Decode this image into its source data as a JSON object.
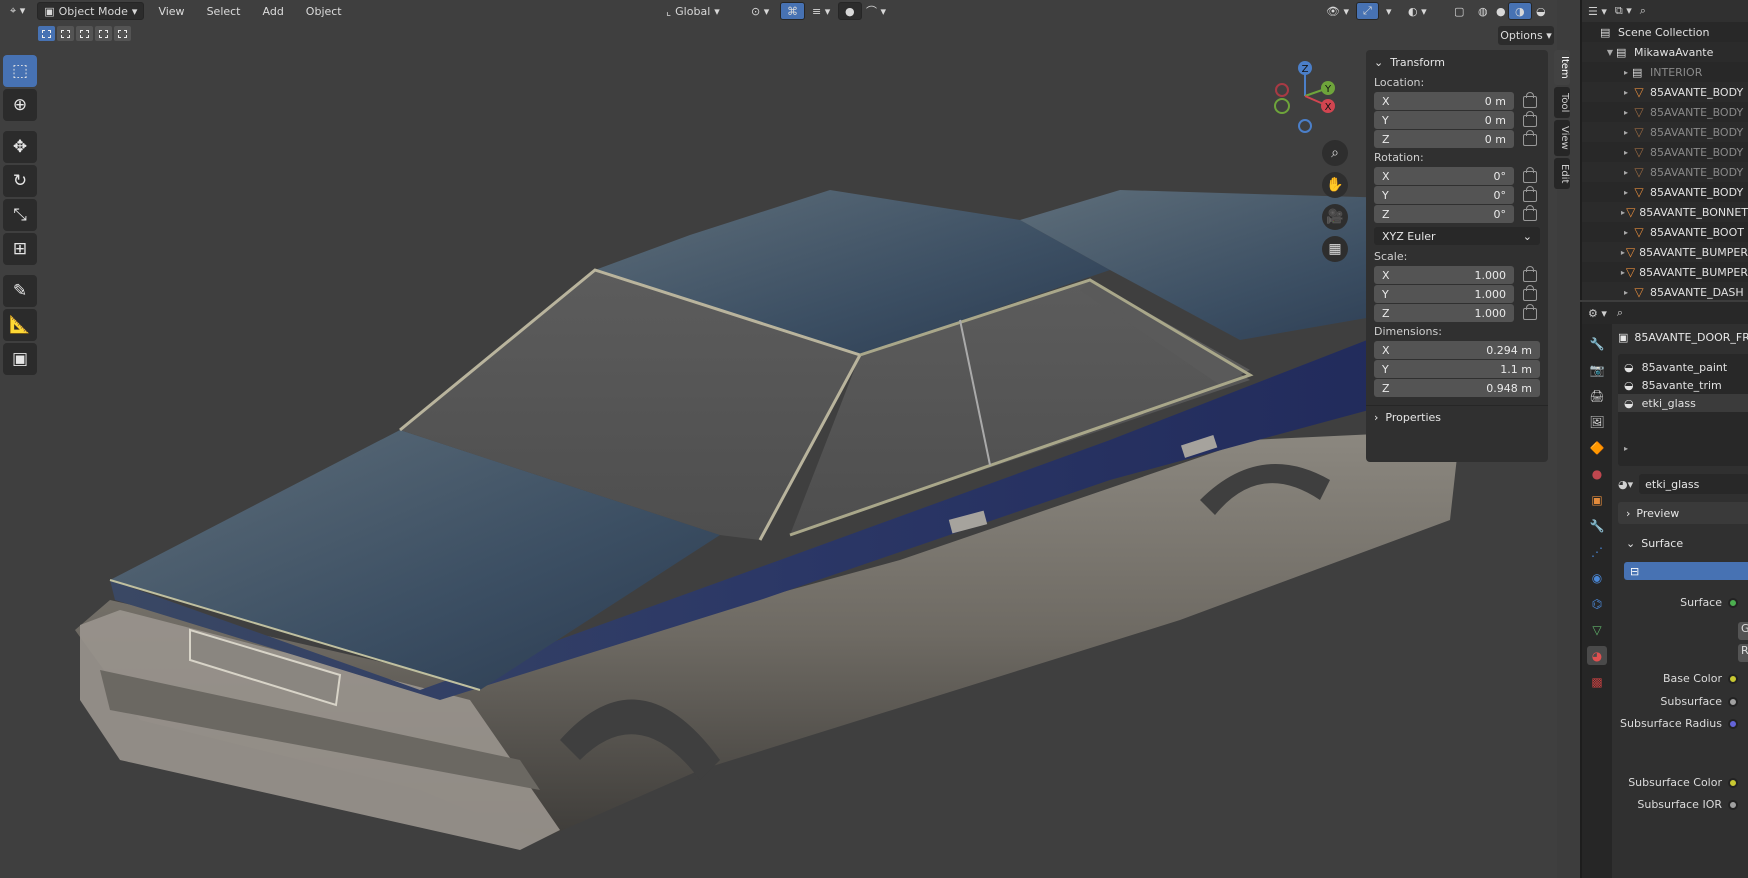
{
  "header": {
    "mode": "Object Mode",
    "menus": [
      "View",
      "Select",
      "Add",
      "Object"
    ],
    "orientation": "Global",
    "options_label": "Options"
  },
  "gizmo": {
    "z": "Z",
    "y": "Y",
    "x": "X"
  },
  "npanel": {
    "tabs": [
      "Item",
      "Tool",
      "View",
      "Edit"
    ],
    "transform_title": "Transform",
    "location_label": "Location:",
    "location": [
      {
        "axis": "X",
        "value": "0 m"
      },
      {
        "axis": "Y",
        "value": "0 m"
      },
      {
        "axis": "Z",
        "value": "0 m"
      }
    ],
    "rotation_label": "Rotation:",
    "rotation": [
      {
        "axis": "X",
        "value": "0°"
      },
      {
        "axis": "Y",
        "value": "0°"
      },
      {
        "axis": "Z",
        "value": "0°"
      }
    ],
    "rotation_mode": "XYZ Euler",
    "scale_label": "Scale:",
    "scale": [
      {
        "axis": "X",
        "value": "1.000"
      },
      {
        "axis": "Y",
        "value": "1.000"
      },
      {
        "axis": "Z",
        "value": "1.000"
      }
    ],
    "dimensions_label": "Dimensions:",
    "dimensions": [
      {
        "axis": "X",
        "value": "0.294 m"
      },
      {
        "axis": "Y",
        "value": "1.1 m"
      },
      {
        "axis": "Z",
        "value": "0.948 m"
      }
    ],
    "properties_title": "Properties"
  },
  "outliner": {
    "scene_collection": "Scene Collection",
    "collection": "MikawaAvante",
    "items": [
      {
        "name": "INTERIOR",
        "dim": true,
        "kind": "collection"
      },
      {
        "name": "85AVANTE_BODY",
        "dim": false,
        "kind": "mesh"
      },
      {
        "name": "85AVANTE_BODY",
        "dim": true,
        "kind": "mesh"
      },
      {
        "name": "85AVANTE_BODY",
        "dim": true,
        "kind": "mesh"
      },
      {
        "name": "85AVANTE_BODY",
        "dim": true,
        "kind": "mesh"
      },
      {
        "name": "85AVANTE_BODY",
        "dim": true,
        "kind": "mesh"
      },
      {
        "name": "85AVANTE_BODY",
        "dim": false,
        "kind": "mesh"
      },
      {
        "name": "85AVANTE_BONNET",
        "dim": false,
        "kind": "mesh"
      },
      {
        "name": "85AVANTE_BOOT",
        "dim": false,
        "kind": "mesh"
      },
      {
        "name": "85AVANTE_BUMPER",
        "dim": false,
        "kind": "mesh"
      },
      {
        "name": "85AVANTE_BUMPER",
        "dim": false,
        "kind": "mesh"
      },
      {
        "name": "85AVANTE_DASH",
        "dim": false,
        "kind": "mesh"
      }
    ]
  },
  "properties": {
    "object_name": "85AVANTE_DOOR_FR",
    "slots": [
      "85avante_paint",
      "85avante_trim",
      "etki_glass"
    ],
    "active_slot": 2,
    "material_name": "etki_glass",
    "preview_label": "Preview",
    "surface_panel": "Surface",
    "surface_button": "Use Nodes",
    "rows": [
      {
        "label": "Surface",
        "color": "#4caf50"
      },
      {
        "label": "",
        "field": "G"
      },
      {
        "label": "",
        "field": "R"
      },
      {
        "label": "Base Color",
        "color": "#c8c832"
      },
      {
        "label": "Subsurface",
        "color": "#a0a0a0"
      },
      {
        "label": "Subsurface Radius",
        "color": "#6464d8"
      },
      {
        "label": "Subsurface Color",
        "color": "#c8c832"
      },
      {
        "label": "Subsurface IOR",
        "color": "#a0a0a0"
      }
    ]
  }
}
